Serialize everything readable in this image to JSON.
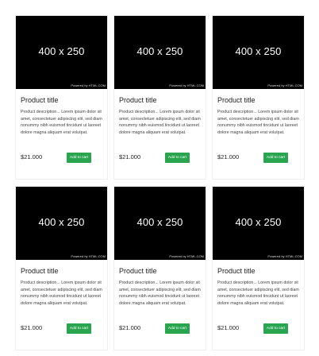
{
  "colors": {
    "image_bg": "#000000",
    "button_bg": "#2aa54f",
    "button_text": "#ffffff"
  },
  "products": [
    {
      "image_label": "400 x 250",
      "image_credit": "Powered by HTML.COM",
      "title": "Product title",
      "description": "Product description... Lorem ipsum dolor sit amet, consectetuer adipiscing elit, sed diam nonummy nibh euismod tincidunt ut laoreet dolore magna aliquam erat volutpat.",
      "price": "$21.000",
      "button_label": "Add to cart"
    },
    {
      "image_label": "400 x 250",
      "image_credit": "Powered by HTML.COM",
      "title": "Product title",
      "description": "Product description... Lorem ipsum dolor sit amet, consectetuer adipiscing elit, sed diam nonummy nibh euismod tincidunt ut laoreet dolore magna aliquam erat volutpat.",
      "price": "$21.000",
      "button_label": "Add to cart"
    },
    {
      "image_label": "400 x 250",
      "image_credit": "Powered by HTML.COM",
      "title": "Product title",
      "description": "Product description... Lorem ipsum dolor sit amet, consectetuer adipiscing elit, sed diam nonummy nibh euismod tincidunt ut laoreet dolore magna aliquam erat volutpat.",
      "price": "$21.000",
      "button_label": "Add to cart"
    },
    {
      "image_label": "400 x 250",
      "image_credit": "Powered by HTML.COM",
      "title": "Product title",
      "description": "Product description... Lorem ipsum dolor sit amet, consectetuer adipiscing elit, sed diam nonummy nibh euismod tincidunt ut laoreet dolore magna aliquam erat volutpat.",
      "price": "$21.000",
      "button_label": "Add to cart"
    },
    {
      "image_label": "400 x 250",
      "image_credit": "Powered by HTML.COM",
      "title": "Product title",
      "description": "Product description... Lorem ipsum dolor sit amet, consectetuer adipiscing elit, sed diam nonummy nibh euismod tincidunt ut laoreet dolore magna aliquam erat volutpat.",
      "price": "$21.000",
      "button_label": "Add to cart"
    },
    {
      "image_label": "400 x 250",
      "image_credit": "Powered by HTML.COM",
      "title": "Product title",
      "description": "Product description... Lorem ipsum dolor sit amet, consectetuer adipiscing elit, sed diam nonummy nibh euismod tincidunt ut laoreet dolore magna aliquam erat volutpat.",
      "price": "$21.000",
      "button_label": "Add to cart"
    }
  ]
}
